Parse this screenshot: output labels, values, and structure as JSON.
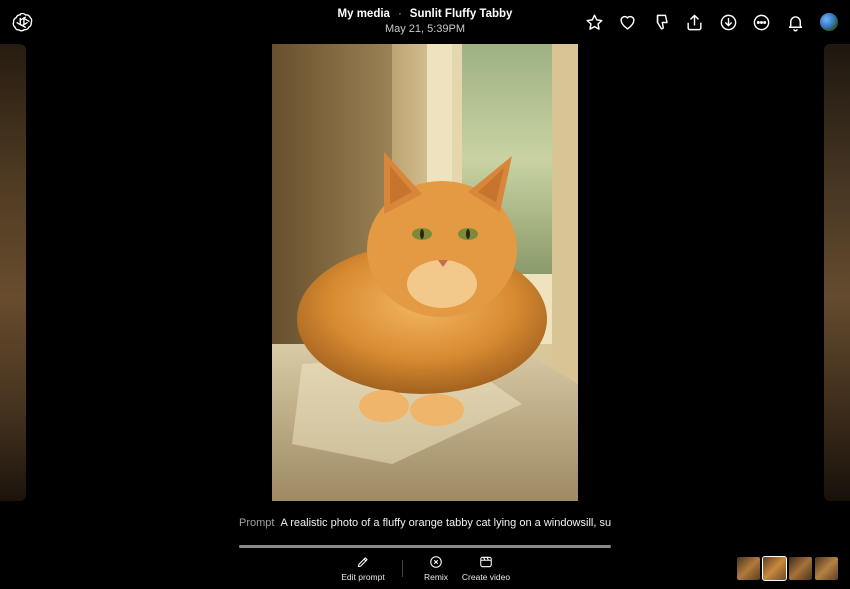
{
  "header": {
    "breadcrumb": "My media",
    "separator": "·",
    "title": "Sunlit Fluffy Tabby",
    "date": "May 21, 5:39PM"
  },
  "toolbar_icons": [
    "star-icon",
    "heart-icon",
    "thumbs-down-icon",
    "share-icon",
    "download-icon",
    "more-icon",
    "bell-icon"
  ],
  "prompt": {
    "label": "Prompt",
    "text": "A realistic photo of a fluffy orange tabby cat lying on a windowsill, su..."
  },
  "playback_progress": 1.0,
  "actions": {
    "edit": "Edit prompt",
    "remix": "Remix",
    "video": "Create video"
  },
  "thumbnails_count": 4,
  "colors": {
    "background": "#000000",
    "text": "#ffffff",
    "muted": "#a0a0a0"
  }
}
